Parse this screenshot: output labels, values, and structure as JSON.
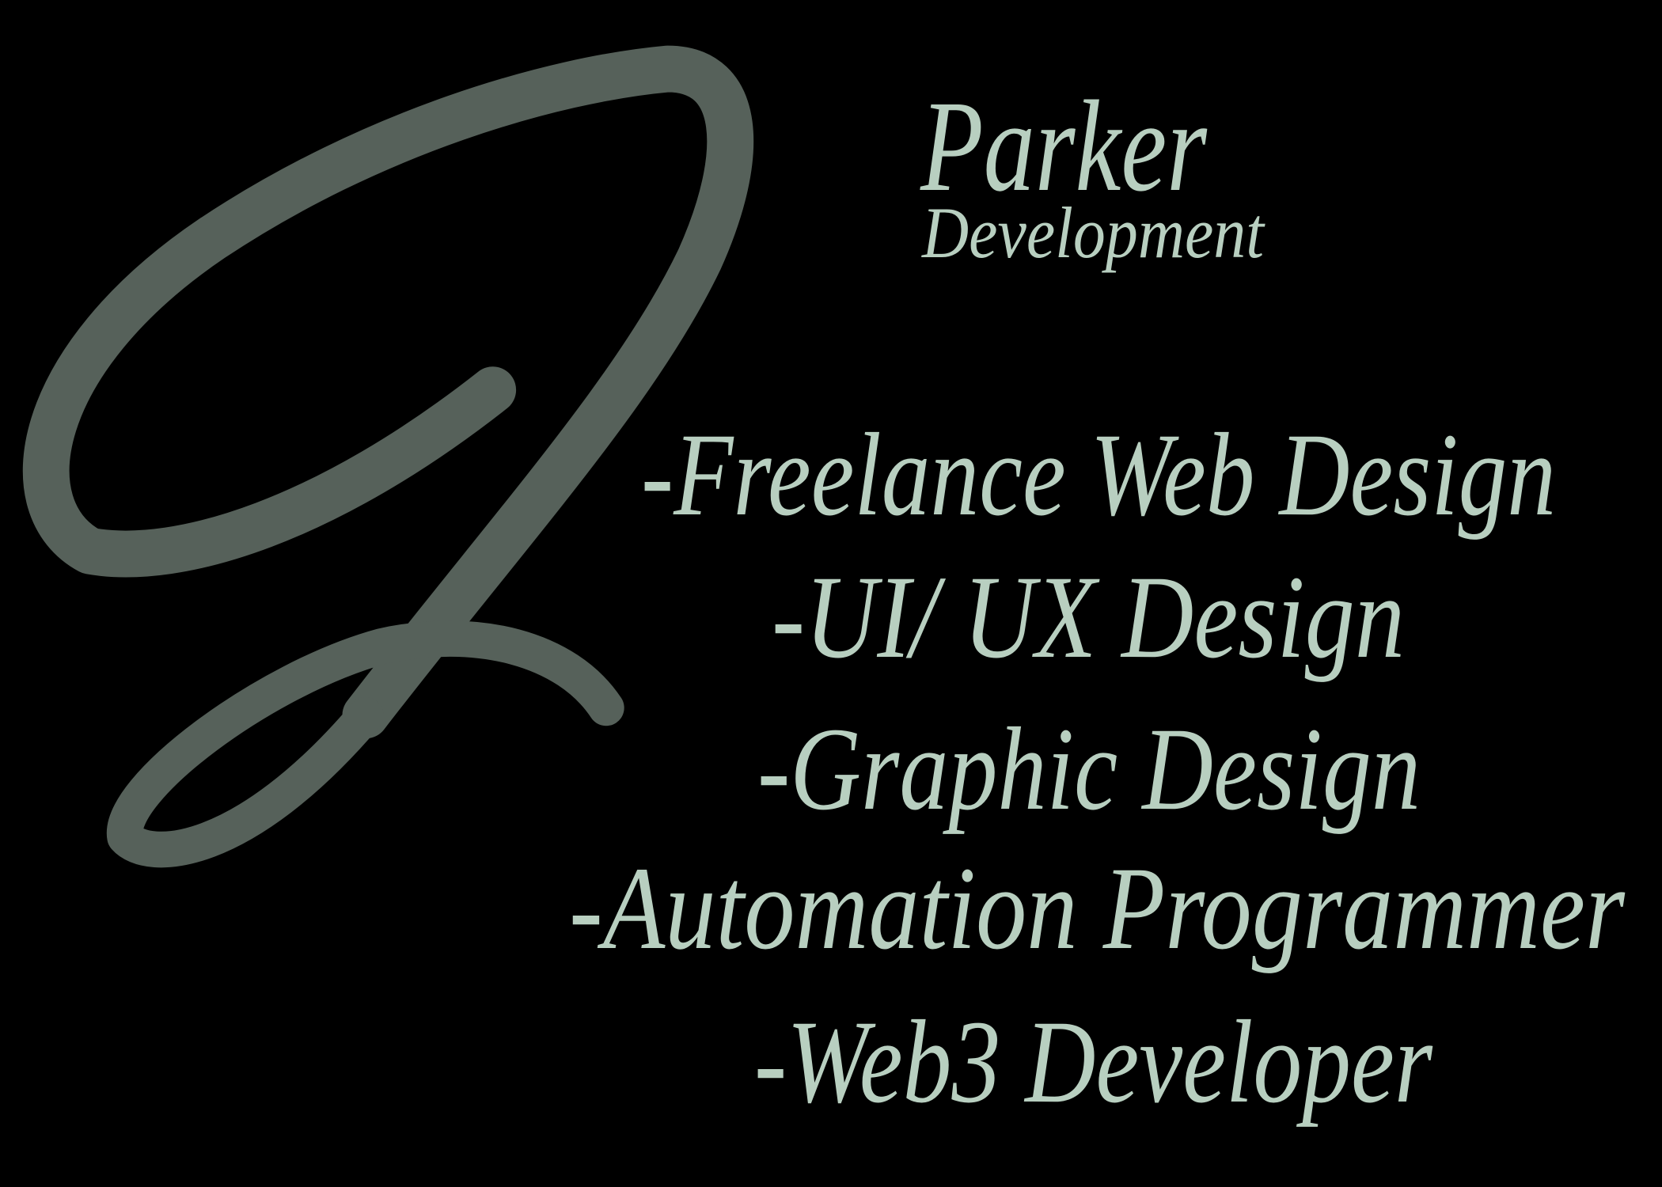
{
  "brand": {
    "logo_letter": "J",
    "name": "Parker",
    "subtitle": "Development",
    "text_color": "#b8cfc0",
    "logo_color": "#56615a",
    "background": "#000000"
  },
  "services": [
    "-Freelance Web Design",
    "-UI/ UX Design",
    "-Graphic Design",
    "-Automation Programmer",
    "-Web3 Developer"
  ]
}
